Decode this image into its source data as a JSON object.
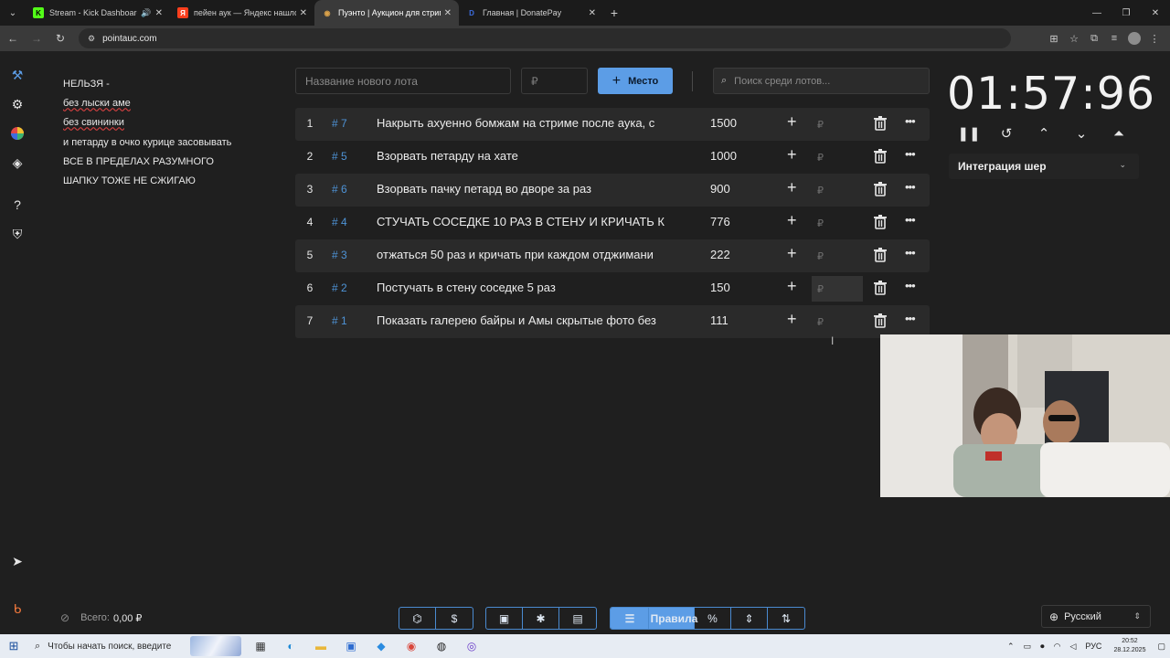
{
  "browser": {
    "tabs": [
      {
        "title": "Stream - Kick Dashboard",
        "favicon": "K",
        "favicon_color": "#53fc18",
        "sound": "🔊",
        "active": false
      },
      {
        "title": "пейен аук — Яндекс нашлось",
        "favicon": "Я",
        "favicon_color": "#fc3f1d",
        "active": false
      },
      {
        "title": "Пуэнто | Аукцион для стриме",
        "favicon": "◉",
        "favicon_color": "#d9a14a",
        "active": true
      },
      {
        "title": "Главная | DonatePay",
        "favicon": "D",
        "favicon_color": "#3d6de0",
        "active": false
      }
    ],
    "url": "pointauc.com"
  },
  "rules": {
    "lines": [
      "НЕЛЬЗЯ -",
      "без лыски аме",
      "без свининки",
      "и петарду в очко курице засовывать",
      "ВСЕ В ПРЕДЕЛАХ РАЗУМНОГО",
      "ШАПКУ ТОЖЕ НЕ СЖИГАЮ"
    ]
  },
  "controls": {
    "lot_placeholder": "Название нового лота",
    "price_placeholder": "₽",
    "place_button": "Место",
    "search_placeholder": "Поиск среди лотов..."
  },
  "lots": [
    {
      "index": "1",
      "id": "# 7",
      "name": "Накрыть ахуенно бомжам на стриме после аука, с",
      "amount": "1500"
    },
    {
      "index": "2",
      "id": "# 5",
      "name": "Взорвать петарду на хате",
      "amount": "1000"
    },
    {
      "index": "3",
      "id": "# 6",
      "name": "Взорвать пачку петард во дворе за раз",
      "amount": "900"
    },
    {
      "index": "4",
      "id": "# 4",
      "name": "СТУЧАТЬ СОСЕДКЕ 10 РАЗ В СТЕНУ И КРИЧАТЬ К",
      "amount": "776"
    },
    {
      "index": "5",
      "id": "# 3",
      "name": "отжаться 50 раз и кричать при каждом отджимани",
      "amount": "222"
    },
    {
      "index": "6",
      "id": "# 2",
      "name": "Постучать в стену соседке 5 раз",
      "amount": "150"
    },
    {
      "index": "7",
      "id": "# 1",
      "name": "Показать галерею байры и Амы скрытые фото без",
      "amount": "111"
    }
  ],
  "lot_price_placeholder": "₽",
  "timer": {
    "value": "01:57:96"
  },
  "integration": {
    "label": "Интеграция шер"
  },
  "footer": {
    "total_label": "Всего:",
    "total_value": "0,00 ₽",
    "rules_button": "Правила",
    "language": "Русский"
  },
  "taskbar": {
    "search_placeholder": "Чтобы начать поиск, введите",
    "lang": "РУС",
    "time": "20:52",
    "date": "28.12.2025"
  },
  "colors": {
    "accent": "#5c9de6",
    "lot_id": "#4e93d6",
    "background": "#1f1f1f"
  }
}
